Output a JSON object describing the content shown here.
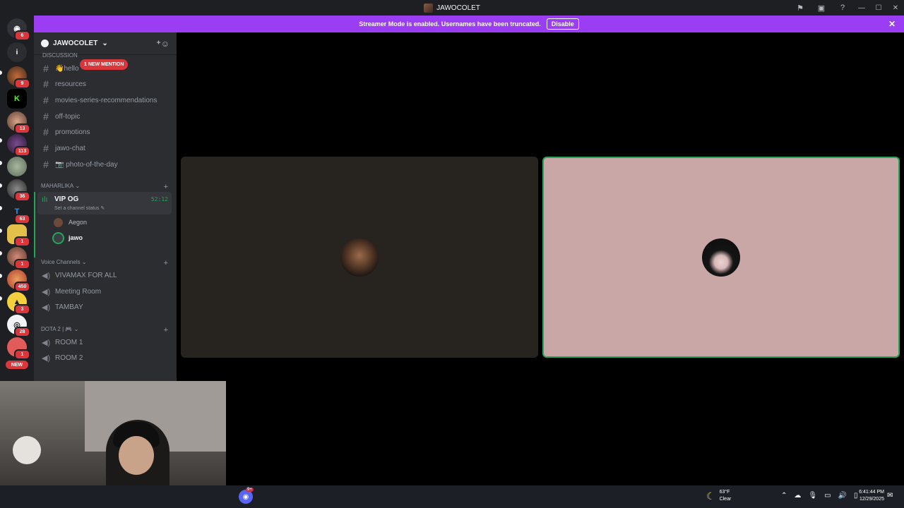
{
  "window": {
    "title": "JAWOCOLET"
  },
  "banner": {
    "text": "Streamer Mode is enabled. Usernames have been truncated.",
    "disable_label": "Disable"
  },
  "guilds": {
    "badges": [
      "6",
      "9",
      "13",
      "113",
      "36",
      "63",
      "1",
      "1",
      "450",
      "3",
      "28",
      "1"
    ],
    "new_label": "NEW"
  },
  "server": {
    "name": "JAWOCOLET",
    "category_cut": "DISCUSSION",
    "mention_label": "1 NEW MENTION",
    "text_channels": [
      "hello",
      "resources",
      "movies-series-recommendations",
      "off-topic",
      "promotions",
      "jawo-chat",
      "photo-of-the-day"
    ],
    "category_maharlika": "MAHARLIKA",
    "voice_active": {
      "name": "VIP OG",
      "status": "Set a channel status",
      "timer": "52:12",
      "users": [
        "Aegon",
        "jawo"
      ]
    },
    "category_voice": "Voice Channels",
    "voice_channels": [
      "VIVAMAX FOR ALL",
      "Meeting Room",
      "TAMBAY"
    ],
    "category_dota": "DOTA 2 |",
    "dota_channels": [
      "ROOM 1",
      "ROOM 2"
    ]
  },
  "taskbar": {
    "discord_badge": "9+",
    "weather_temp": "63°F",
    "weather_cond": "Clear",
    "time": "6:41:44 PM",
    "date": "12/29/2025"
  },
  "colors": {
    "banner": "#9b3df2",
    "speaking_green": "#23a55a",
    "mention_red": "#da373c"
  }
}
